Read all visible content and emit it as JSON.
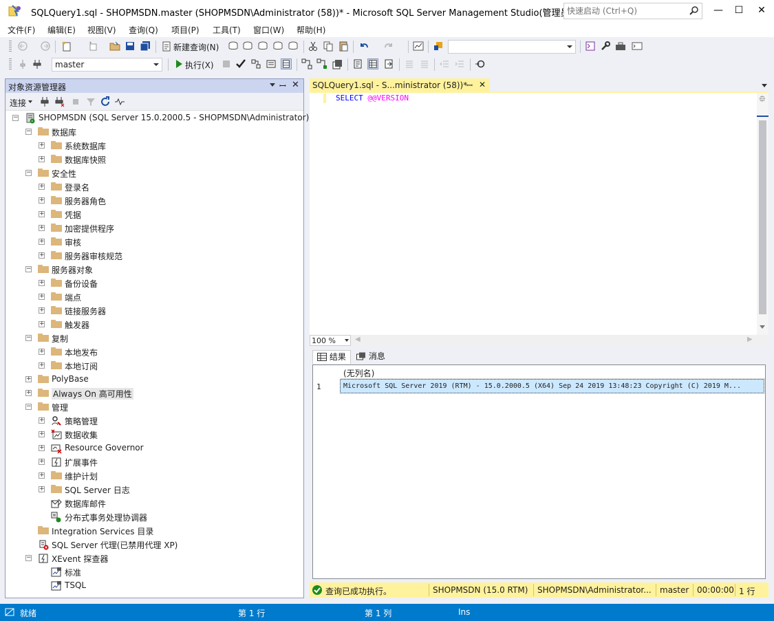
{
  "window": {
    "title": "SQLQuery1.sql - SHOPMSDN.master (SHOPMSDN\\Administrator (58))* - Microsoft SQL Server Management Studio(管理员)",
    "quick_launch_placeholder": "快速启动 (Ctrl+Q)",
    "minimize": "—",
    "maximize": "☐",
    "close": "✕"
  },
  "menu": [
    "文件(F)",
    "编辑(E)",
    "视图(V)",
    "查询(Q)",
    "项目(P)",
    "工具(T)",
    "窗口(W)",
    "帮助(H)"
  ],
  "toolbar1": {
    "new_query_label": "新建查询(N)",
    "mdx": "MDX",
    "dmx": "DMX",
    "xmla": "XMLA",
    "dax": "DAX",
    "search_combo_value": ""
  },
  "toolbar2": {
    "database": "master",
    "execute_label": "执行(X)"
  },
  "object_explorer": {
    "title": "对象资源管理器",
    "connect_label": "连接",
    "tree": [
      {
        "label": "SHOPMSDN (SQL Server 15.0.2000.5 - SHOPMSDN\\Administrator)",
        "level": 0,
        "expander": "minus",
        "icon": "server-icon"
      },
      {
        "label": "数据库",
        "level": 1,
        "expander": "minus",
        "icon": "folder-icon"
      },
      {
        "label": "系统数据库",
        "level": 2,
        "expander": "plus",
        "icon": "folder-icon"
      },
      {
        "label": "数据库快照",
        "level": 2,
        "expander": "plus",
        "icon": "folder-icon"
      },
      {
        "label": "安全性",
        "level": 1,
        "expander": "minus",
        "icon": "folder-icon"
      },
      {
        "label": "登录名",
        "level": 2,
        "expander": "plus",
        "icon": "folder-icon"
      },
      {
        "label": "服务器角色",
        "level": 2,
        "expander": "plus",
        "icon": "folder-icon"
      },
      {
        "label": "凭据",
        "level": 2,
        "expander": "plus",
        "icon": "folder-icon"
      },
      {
        "label": "加密提供程序",
        "level": 2,
        "expander": "plus",
        "icon": "folder-icon"
      },
      {
        "label": "审核",
        "level": 2,
        "expander": "plus",
        "icon": "folder-icon"
      },
      {
        "label": "服务器审核规范",
        "level": 2,
        "expander": "plus",
        "icon": "folder-icon"
      },
      {
        "label": "服务器对象",
        "level": 1,
        "expander": "minus",
        "icon": "folder-icon"
      },
      {
        "label": "备份设备",
        "level": 2,
        "expander": "plus",
        "icon": "folder-icon"
      },
      {
        "label": "端点",
        "level": 2,
        "expander": "plus",
        "icon": "folder-icon"
      },
      {
        "label": "链接服务器",
        "level": 2,
        "expander": "plus",
        "icon": "folder-icon"
      },
      {
        "label": "触发器",
        "level": 2,
        "expander": "plus",
        "icon": "folder-icon"
      },
      {
        "label": "复制",
        "level": 1,
        "expander": "minus",
        "icon": "folder-icon"
      },
      {
        "label": "本地发布",
        "level": 2,
        "expander": "plus",
        "icon": "folder-icon"
      },
      {
        "label": "本地订阅",
        "level": 2,
        "expander": "plus",
        "icon": "folder-icon"
      },
      {
        "label": "PolyBase",
        "level": 1,
        "expander": "plus",
        "icon": "folder-icon"
      },
      {
        "label": "Always On 高可用性",
        "level": 1,
        "expander": "plus",
        "icon": "folder-icon",
        "selected": true
      },
      {
        "label": "管理",
        "level": 1,
        "expander": "minus",
        "icon": "folder-icon"
      },
      {
        "label": "策略管理",
        "level": 2,
        "expander": "plus",
        "icon": "policy-icon"
      },
      {
        "label": "数据收集",
        "level": 2,
        "expander": "plus",
        "icon": "data-collection-icon"
      },
      {
        "label": "Resource Governor",
        "level": 2,
        "expander": "plus",
        "icon": "resource-governor-icon"
      },
      {
        "label": "扩展事件",
        "level": 2,
        "expander": "plus",
        "icon": "extended-events-icon"
      },
      {
        "label": "维护计划",
        "level": 2,
        "expander": "plus",
        "icon": "folder-icon"
      },
      {
        "label": "SQL Server 日志",
        "level": 2,
        "expander": "plus",
        "icon": "folder-icon"
      },
      {
        "label": "数据库邮件",
        "level": 2,
        "expander": "none",
        "icon": "database-mail-icon"
      },
      {
        "label": "分布式事务处理协调器",
        "level": 2,
        "expander": "none",
        "icon": "dtc-icon"
      },
      {
        "label": "Integration Services 目录",
        "level": 1,
        "expander": "none",
        "icon": "folder-icon"
      },
      {
        "label": "SQL Server 代理(已禁用代理 XP)",
        "level": 1,
        "expander": "none",
        "icon": "sql-agent-icon"
      },
      {
        "label": "XEvent 探查器",
        "level": 1,
        "expander": "minus",
        "icon": "xevent-profiler-icon"
      },
      {
        "label": "标准",
        "level": 2,
        "expander": "none",
        "icon": "session-icon"
      },
      {
        "label": "TSQL",
        "level": 2,
        "expander": "none",
        "icon": "session-icon"
      }
    ]
  },
  "editor": {
    "tab_label": "SQLQuery1.sql - S...ministrator (58))*",
    "code_keyword": "SELECT",
    "code_var": "@@VERSION",
    "zoom": "100 %"
  },
  "results": {
    "tab_results": "结果",
    "tab_messages": "消息",
    "column_header": "(无列名)",
    "row_number": "1",
    "row_value": "Microsoft SQL Server 2019 (RTM) - 15.0.2000.5 (X64)   Sep 24 2019 13:48:23   Copyright (C) 2019 M..."
  },
  "query_status": {
    "message": "查询已成功执行。",
    "server": "SHOPMSDN (15.0 RTM)",
    "user": "SHOPMSDN\\Administrator...",
    "database": "master",
    "elapsed": "00:00:00",
    "rows": "1 行"
  },
  "statusbar": {
    "state": "就绪",
    "line": "第 1 行",
    "col": "第 1 列",
    "mode": "Ins"
  },
  "colors": {
    "accent": "#007acc",
    "tab_yellow": "#fff29d",
    "keyword": "#0000ff",
    "variable": "#ff00ff",
    "folder": "#dcb67a",
    "success_green": "#1e8a1e"
  }
}
